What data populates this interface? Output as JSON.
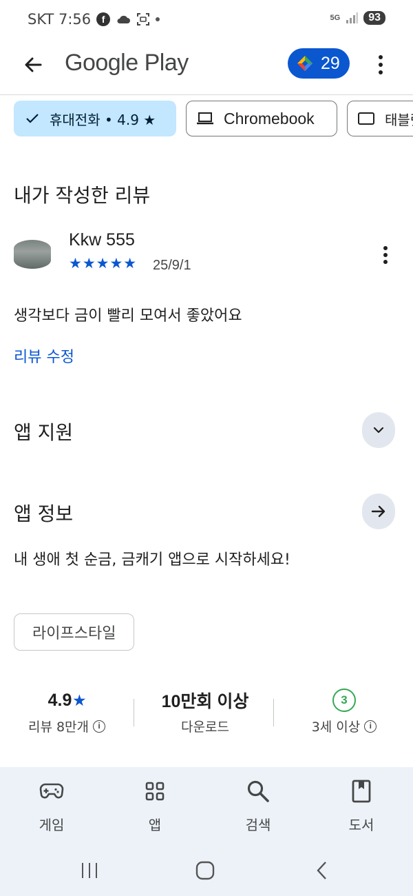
{
  "status_bar": {
    "carrier_time": "SKT 7:56",
    "network": "5G",
    "battery": "93"
  },
  "app_bar": {
    "title": "Google Play",
    "points": "29"
  },
  "device_chips": [
    {
      "label": "휴대전화 • 4.9 ★"
    },
    {
      "label": "Chromebook"
    },
    {
      "label": "태블릿"
    }
  ],
  "my_review": {
    "heading": "내가 작성한 리뷰",
    "reviewer": "Kkw 555",
    "stars": "★★★★★",
    "date": "25/9/1",
    "text": "생각보다 금이 빨리 모여서 좋았어요",
    "edit_label": "리뷰 수정"
  },
  "app_support": {
    "heading": "앱 지원"
  },
  "app_info": {
    "heading": "앱 정보",
    "description": "내 생애 첫 순금, 금캐기 앱으로 시작하세요!",
    "category": "라이프스타일"
  },
  "stats": {
    "rating_value": "4.9",
    "rating_star": "★",
    "rating_label": "리뷰 8만개",
    "downloads_value": "10만회 이상",
    "downloads_label": "다운로드",
    "age_value": "3",
    "age_label": "3세 이상"
  },
  "bottom_nav": {
    "items": [
      {
        "label": "게임"
      },
      {
        "label": "앱"
      },
      {
        "label": "검색"
      },
      {
        "label": "도서"
      }
    ]
  },
  "colors": {
    "accent": "#0b57d0",
    "chip_selected": "#c2e7ff",
    "nav_bg": "#edf2f9"
  }
}
